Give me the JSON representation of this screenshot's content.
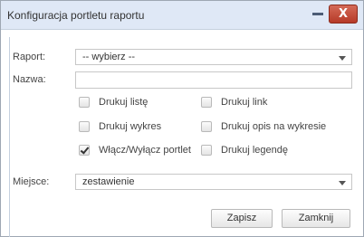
{
  "window": {
    "title": "Konfiguracja portletu raportu",
    "close_glyph": "X"
  },
  "form": {
    "raport_label": "Raport:",
    "raport_value": "-- wybierz --",
    "nazwa_label": "Nazwa:",
    "nazwa_value": "",
    "checkboxes": [
      {
        "label": "Drukuj listę",
        "checked": false
      },
      {
        "label": "Drukuj link",
        "checked": false
      },
      {
        "label": "Drukuj wykres",
        "checked": false
      },
      {
        "label": "Drukuj opis na wykresie",
        "checked": false
      },
      {
        "label": "Włącz/Wyłącz portlet",
        "checked": true
      },
      {
        "label": "Drukuj legendę",
        "checked": false
      }
    ],
    "miejsce_label": "Miejsce:",
    "miejsce_value": "zestawienie"
  },
  "buttons": {
    "save": "Zapisz",
    "close": "Zamknij"
  }
}
